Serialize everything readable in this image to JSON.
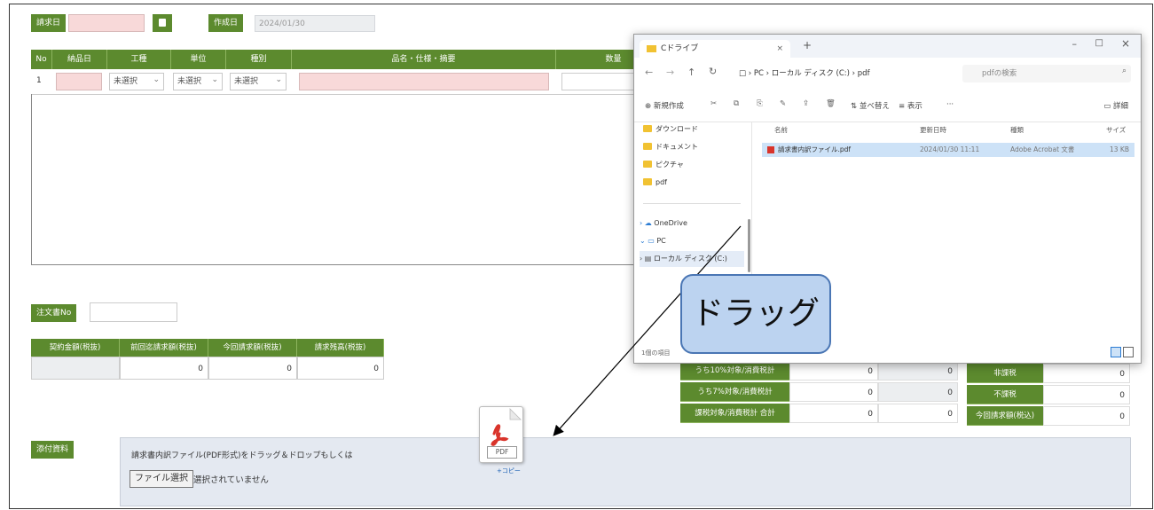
{
  "header": {
    "invoice_date_label": "請求日",
    "issue_date_label": "作成日",
    "issue_date_value": "2024/01/30"
  },
  "table": {
    "columns": [
      "No",
      "納品日",
      "工種",
      "単位",
      "種別",
      "品名・仕様・摘要",
      "数量"
    ],
    "row": {
      "no": "1",
      "koshu": "未選択",
      "tani": "未選択",
      "shubetsu": "未選択"
    }
  },
  "order_no_label": "注文書No",
  "summary": {
    "headers": [
      "契約金額(税抜)",
      "前回迄請求額(税抜)",
      "今回請求額(税抜)",
      "請求残高(税抜)"
    ],
    "values": [
      "",
      "0",
      "0",
      "0"
    ]
  },
  "tax": {
    "rows": [
      {
        "label": "うち10%対象/消費税計",
        "v1": "0",
        "v2": "0"
      },
      {
        "label": "うち7%対象/消費税計",
        "v1": "0",
        "v2": "0"
      },
      {
        "label": "課税対象/消費税計 合計",
        "v1": "0",
        "v2": "0"
      }
    ],
    "right": [
      {
        "label": "非課税",
        "value": "0"
      },
      {
        "label": "不課税",
        "value": "0"
      },
      {
        "label": "今回請求額(税込)",
        "value": "0"
      }
    ]
  },
  "attachment": {
    "label": "添付資料",
    "instruction": "請求書内訳ファイル(PDF形式)をドラッグ＆ドロップもしくは",
    "file_button": "ファイル選択",
    "no_file": "選択されていません"
  },
  "explorer": {
    "tab_title": "Cドライブ",
    "breadcrumb": [
      "PC",
      "ローカル ディスク (C:)",
      "pdf"
    ],
    "search_placeholder": "pdfの検索",
    "toolbar": [
      "新規作成",
      "並べ替え",
      "表示",
      "詳細"
    ],
    "tree": [
      "ダウンロード",
      "ドキュメント",
      "ピクチャ",
      "pdf",
      "OneDrive",
      "PC",
      "ローカル ディスク (C:)"
    ],
    "columns": [
      "名前",
      "更新日時",
      "種類",
      "サイズ"
    ],
    "file": {
      "name": "請求書内訳ファイル.pdf",
      "date": "2024/01/30 11:11",
      "type": "Adobe Acrobat 文書",
      "size": "13 KB"
    },
    "status": "1個の項目"
  },
  "callout": "ドラッグ",
  "pdf_icon_label": "PDF",
  "copy_label": "+コピー",
  "colors": {
    "green": "#5c8a2e",
    "pink": "#f8d9d9",
    "callout_bg": "#bcd3f0",
    "callout_border": "#4a76b4",
    "pdf_red": "#d9342b"
  }
}
